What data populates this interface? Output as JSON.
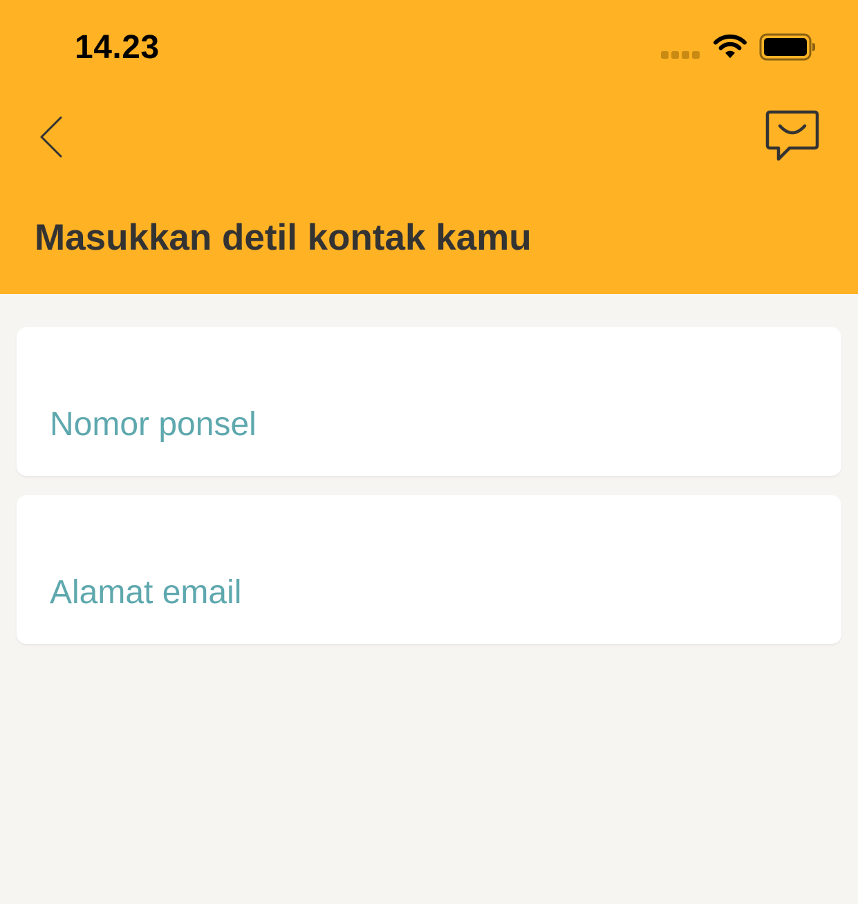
{
  "status_bar": {
    "time": "14.23"
  },
  "header": {
    "title": "Masukkan detil kontak kamu",
    "back_icon": "chevron-left-icon",
    "chat_icon": "chat-smile-icon"
  },
  "form": {
    "phone_placeholder": "Nomor ponsel",
    "phone_value": "",
    "email_placeholder": "Alamat email",
    "email_value": ""
  },
  "colors": {
    "header_bg": "#FFB224",
    "page_bg": "#F6F5F2",
    "placeholder": "#5EA8AE",
    "title_text": "#333333"
  }
}
